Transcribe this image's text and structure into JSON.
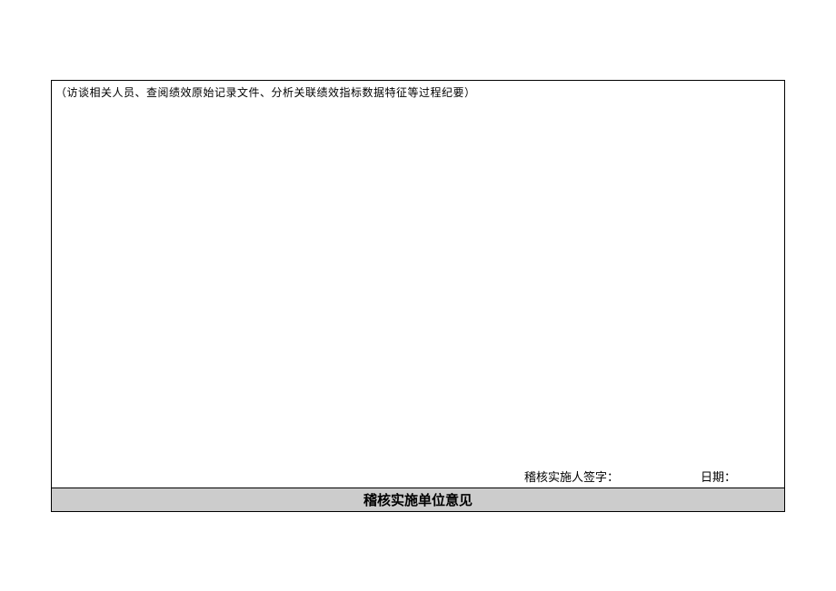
{
  "document": {
    "note_text": "（访谈相关人员、查阅绩效原始记录文件、分析关联绩效指标数据特征等过程纪要）",
    "signature_label": "稽核实施人签字：",
    "date_label": "日期：",
    "section_header": "稽核实施单位意见"
  }
}
